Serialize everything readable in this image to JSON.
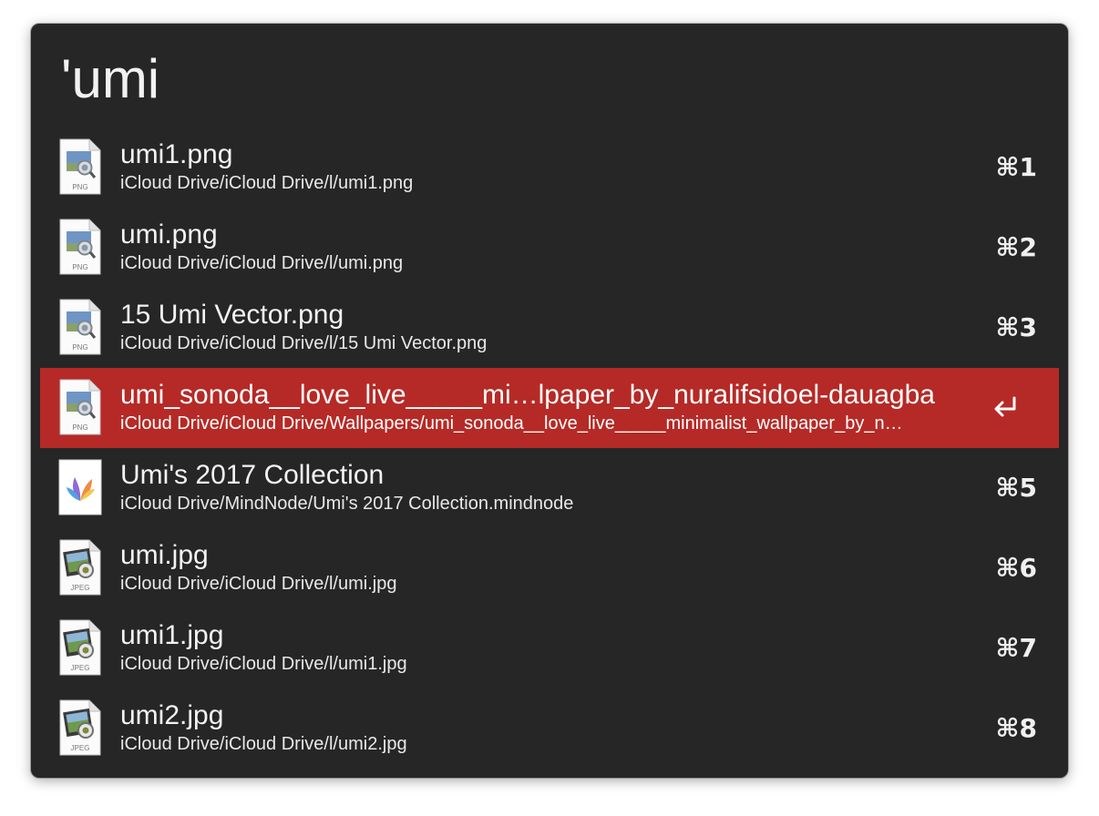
{
  "search": {
    "query": "'umi"
  },
  "results": [
    {
      "title": "umi1.png",
      "subtitle": "iCloud Drive/iCloud Drive/l/umi1.png",
      "shortcut": "⌘1",
      "icon": "png-file-icon",
      "icon_label": "PNG"
    },
    {
      "title": "umi.png",
      "subtitle": "iCloud Drive/iCloud Drive/l/umi.png",
      "shortcut": "⌘2",
      "icon": "png-file-icon",
      "icon_label": "PNG"
    },
    {
      "title": "15 Umi Vector.png",
      "subtitle": "iCloud Drive/iCloud Drive/l/15 Umi Vector.png",
      "shortcut": "⌘3",
      "icon": "png-file-icon",
      "icon_label": "PNG"
    },
    {
      "title": "umi_sonoda__love_live_____mi…lpaper_by_nuralifsidoel-dauagba",
      "subtitle": "iCloud Drive/iCloud Drive/Wallpapers/umi_sonoda__love_live_____minimalist_wallpaper_by_n…",
      "shortcut": "",
      "selected": true,
      "action_icon": "return-icon",
      "icon": "png-file-icon",
      "icon_label": "PNG"
    },
    {
      "title": "Umi's 2017 Collection",
      "subtitle": "iCloud Drive/MindNode/Umi's 2017 Collection.mindnode",
      "shortcut": "⌘5",
      "icon": "mindnode-document-icon"
    },
    {
      "title": "umi.jpg",
      "subtitle": "iCloud Drive/iCloud Drive/l/umi.jpg",
      "shortcut": "⌘6",
      "icon": "jpeg-file-icon",
      "icon_label": "JPEG"
    },
    {
      "title": "umi1.jpg",
      "subtitle": "iCloud Drive/iCloud Drive/l/umi1.jpg",
      "shortcut": "⌘7",
      "icon": "jpeg-file-icon",
      "icon_label": "JPEG"
    },
    {
      "title": "umi2.jpg",
      "subtitle": "iCloud Drive/iCloud Drive/l/umi2.jpg",
      "shortcut": "⌘8",
      "icon": "jpeg-file-icon",
      "icon_label": "JPEG"
    }
  ],
  "colors": {
    "window_background": "#262626",
    "selection": "#b52a26",
    "text": "#f3f3f3"
  }
}
